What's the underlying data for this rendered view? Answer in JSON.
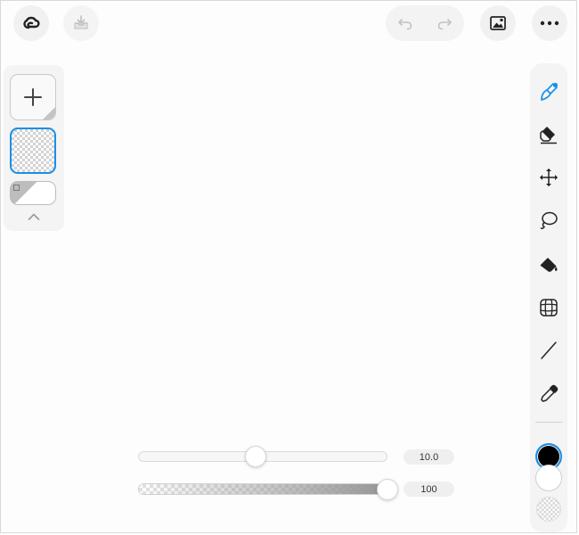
{
  "colors": {
    "accent": "#1a8fe6",
    "primary_color": "#000000",
    "secondary_color": "#ffffff"
  },
  "top_bar": {
    "logo_icon": "creative-cloud-icon",
    "export_icon": "export-tray-icon",
    "undo_icon": "undo-icon",
    "redo_icon": "redo-icon",
    "canvas_icon": "image-icon",
    "more_icon": "more-horizontal-icon"
  },
  "layers": {
    "add_icon": "plus-icon",
    "collapse_icon": "chevron-up-icon",
    "selected_index": 0
  },
  "tools": [
    {
      "name": "brush",
      "icon": "brush-icon",
      "active": true
    },
    {
      "name": "eraser",
      "icon": "eraser-icon",
      "active": false
    },
    {
      "name": "move",
      "icon": "move-arrows-icon",
      "active": false
    },
    {
      "name": "lasso",
      "icon": "lasso-icon",
      "active": false
    },
    {
      "name": "fill",
      "icon": "paint-bucket-icon",
      "active": false
    },
    {
      "name": "grid",
      "icon": "grid-icon",
      "active": false
    },
    {
      "name": "line",
      "icon": "line-icon",
      "active": false
    },
    {
      "name": "eyedropper",
      "icon": "eyedropper-icon",
      "active": false
    }
  ],
  "brush": {
    "size_label": "10.0",
    "size_value": 10.0,
    "size_fraction": 0.47,
    "opacity_label": "100",
    "opacity_value": 100,
    "opacity_fraction": 1.0
  }
}
